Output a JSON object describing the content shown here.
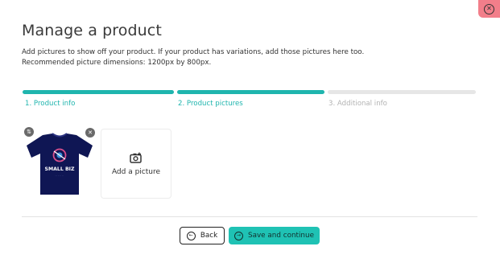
{
  "modal": {
    "title": "Manage a product",
    "description_line1": "Add pictures to show off your product. If your product has variations, add those pictures here too.",
    "description_line2": "Recommended picture dimensions: 1200px by 800px.",
    "close_icon": "close-circle-icon"
  },
  "steps": [
    {
      "label": "1. Product info",
      "state": "complete",
      "color": "#1fb5ae"
    },
    {
      "label": "2. Product pictures",
      "state": "active",
      "color": "#1fb5ae"
    },
    {
      "label": "3. Additional info",
      "state": "pending",
      "color": "#e6e6e6"
    }
  ],
  "pictures": [
    {
      "alt": "Navy t-shirt with SMALL BIZ logo",
      "brand_text": "SMALL BIZ",
      "controls": [
        "reorder-icon",
        "remove-icon"
      ]
    }
  ],
  "add_picture": {
    "label": "Add a picture",
    "icon": "camera-add-icon"
  },
  "footer": {
    "back_label": "Back",
    "save_label": "Save and continue"
  },
  "colors": {
    "accent": "#1fc2b4",
    "close_bg": "#f27e8a"
  }
}
